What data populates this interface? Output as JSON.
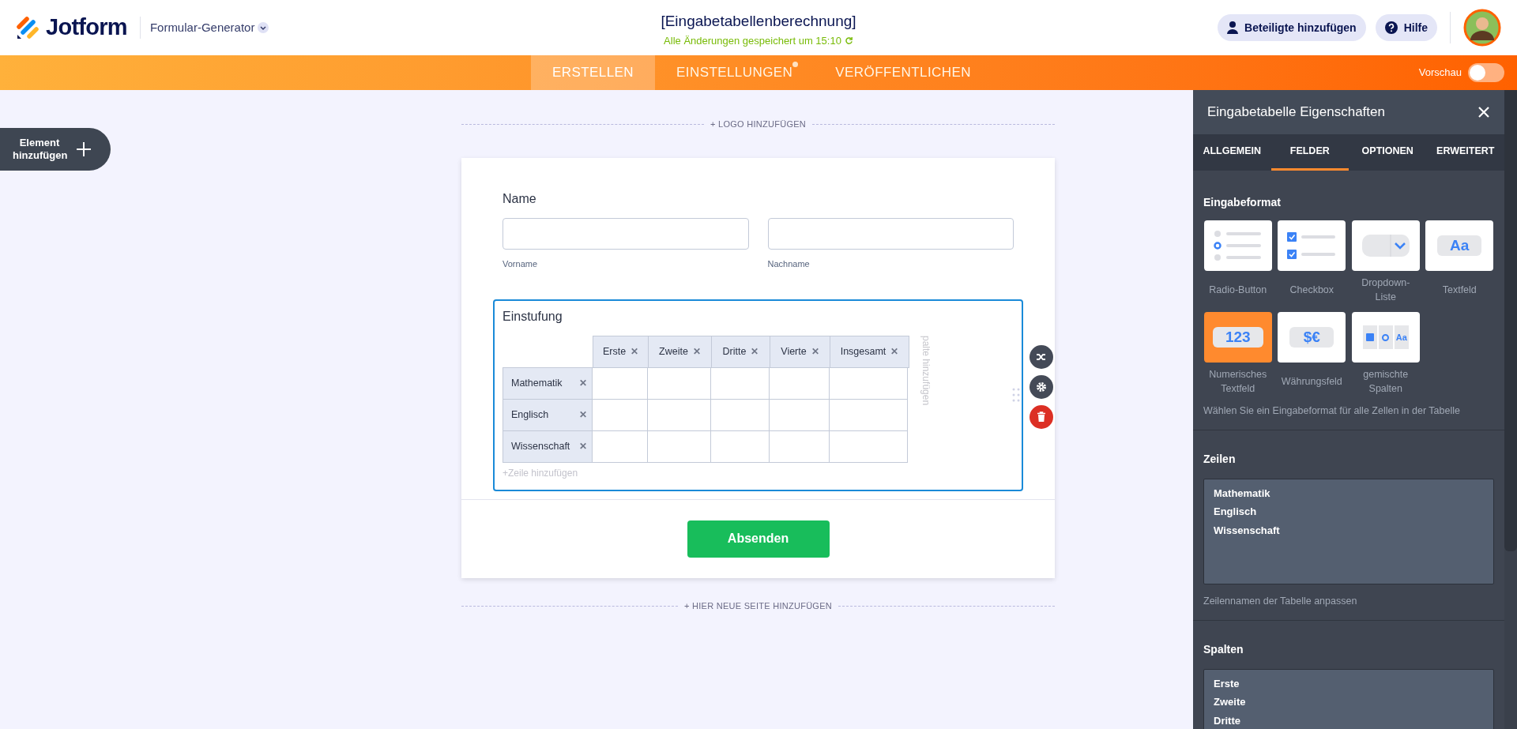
{
  "header": {
    "logo": "Jotform",
    "builder_menu": "Formular-Generator",
    "form_title": "[Eingabetabellenberechnung]",
    "save_status": "Alle Änderungen gespeichert um 15:10",
    "buttons": [
      {
        "kind": "people",
        "label": "Beteiligte hinzufügen"
      },
      {
        "kind": "help",
        "label": "Hilfe"
      }
    ]
  },
  "nav": {
    "tabs": [
      {
        "label": "ERSTELLEN",
        "selected": true,
        "notification": false
      },
      {
        "label": "EINSTELLUNGEN",
        "selected": false,
        "notification": true
      },
      {
        "label": "VERÖFFENTLICHEN",
        "selected": false,
        "notification": false
      }
    ],
    "preview": {
      "label": "Vorschau",
      "on": false
    }
  },
  "add_element": "Element hinzufügen",
  "form": {
    "logo_link": "+ LOGO HINZUFÜGEN",
    "name_field": {
      "label": "Name",
      "inputs": [
        {
          "sublabel": "Vorname"
        },
        {
          "sublabel": "Nachname"
        }
      ]
    },
    "input_table": {
      "title": "Einstufung",
      "columns": [
        "Erste",
        "Zweite",
        "Dritte",
        "Vierte",
        "Insgesamt"
      ],
      "rows": [
        "Mathematik",
        "Englisch",
        "Wissenschaft"
      ],
      "remove_mark": "✕",
      "add_column": "palte hinzufügen",
      "add_row": "+Zeile hinzufügen"
    },
    "submit": "Absenden",
    "add_page": "+ HIER NEUE SEITE HINZUFÜGEN"
  },
  "panel": {
    "title": "Eingabetabelle Eigenschaften",
    "tabs": [
      {
        "label": "ALLGEMEIN",
        "selected": false
      },
      {
        "label": "FELDER",
        "selected": true
      },
      {
        "label": "OPTIONEN",
        "selected": false
      },
      {
        "label": "ERWEITERT",
        "selected": false
      }
    ],
    "input_format": {
      "heading": "Eingabeformat",
      "options": [
        {
          "kind": "radio",
          "label": "Radio-Button",
          "selected": false
        },
        {
          "kind": "checkbox",
          "label": "Checkbox",
          "selected": false
        },
        {
          "kind": "dropdown",
          "label": "Dropdown-Liste",
          "selected": false
        },
        {
          "kind": "text",
          "label": "Textfeld",
          "icon_text": "Aa",
          "selected": false
        },
        {
          "kind": "number",
          "label": "Numerisches Textfeld",
          "icon_text": "123",
          "selected": true
        },
        {
          "kind": "currency",
          "label": "Währungsfeld",
          "icon_text": "$€",
          "selected": false
        },
        {
          "kind": "mixed",
          "label": "gemischte Spalten",
          "icon_text": "Aa",
          "selected": false
        }
      ],
      "help": "Wählen Sie ein Eingabeformat für alle Zellen in der Tabelle"
    },
    "rows_section": {
      "heading": "Zeilen",
      "lines": [
        "Mathematik",
        "Englisch",
        "Wissenschaft"
      ],
      "help": "Zeilennamen der Tabelle anpassen"
    },
    "columns_section": {
      "heading": "Spalten",
      "lines": [
        "Erste",
        "Zweite",
        "Dritte"
      ]
    }
  }
}
